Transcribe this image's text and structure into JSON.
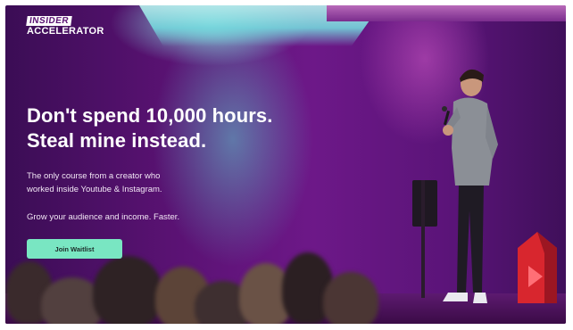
{
  "brand": {
    "logo_line1": "INSIDER",
    "logo_line2": "ACCELERATOR"
  },
  "hero": {
    "headline_line1": "Don't spend 10,000 hours.",
    "headline_line2": "Steal mine instead.",
    "subtitle_line1": "The only course from a creator who",
    "subtitle_line2": "worked inside Youtube & Instagram.",
    "tagline": "Grow your audience and income. Faster.",
    "cta_label": "Join Waitlist"
  },
  "colors": {
    "background": "#5a1273",
    "stage_light": "#74d6dc",
    "cta": "#79e6c2",
    "youtube_red": "#d8262e"
  },
  "icons": [
    "youtube-play-icon",
    "microphone-icon"
  ]
}
